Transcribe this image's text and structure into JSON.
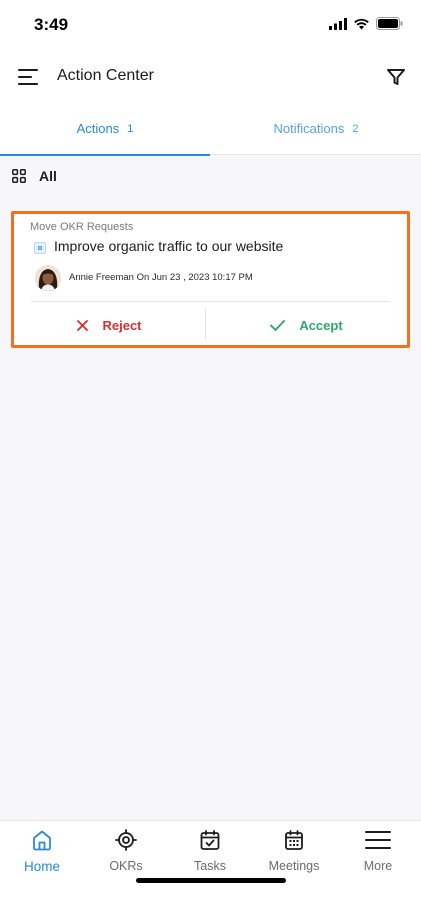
{
  "status_bar": {
    "time": "3:49"
  },
  "header": {
    "title": "Action Center"
  },
  "tabs": [
    {
      "label": "Actions",
      "count": "1",
      "active": true
    },
    {
      "label": "Notifications",
      "count": "2",
      "active": false
    }
  ],
  "filter": {
    "label": "All"
  },
  "card": {
    "category": "Move OKR Requests",
    "title": "Improve organic traffic to our website",
    "requester": "Annie Freeman On Jun 23 , 2023 10:17 PM",
    "reject_label": "Reject",
    "accept_label": "Accept"
  },
  "colors": {
    "accent": "#2b8ad6",
    "highlight_border": "#f37021",
    "reject": "#d62f2f",
    "accept": "#2fa66b"
  },
  "bottom_nav": [
    {
      "label": "Home",
      "icon": "home-icon",
      "active": true
    },
    {
      "label": "OKRs",
      "icon": "target-icon",
      "active": false
    },
    {
      "label": "Tasks",
      "icon": "calendar-check-icon",
      "active": false
    },
    {
      "label": "Meetings",
      "icon": "calendar-grid-icon",
      "active": false
    },
    {
      "label": "More",
      "icon": "hamburger-icon",
      "active": false
    }
  ]
}
